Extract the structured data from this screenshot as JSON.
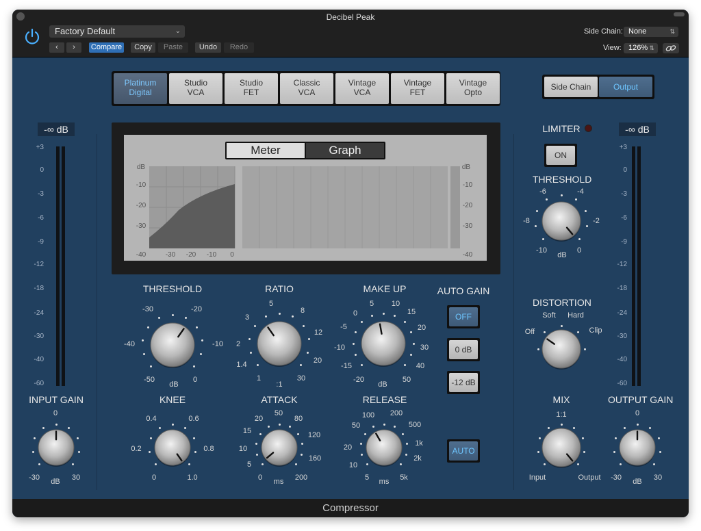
{
  "window": {
    "title": "Decibel Peak",
    "footer": "Compressor"
  },
  "toolbar": {
    "preset": "Factory Default",
    "compare": "Compare",
    "copy": "Copy",
    "paste": "Paste",
    "undo": "Undo",
    "redo": "Redo",
    "side_chain_label": "Side Chain:",
    "side_chain_value": "None",
    "view_label": "View:",
    "view_value": "126%"
  },
  "models": [
    "Platinum\nDigital",
    "Studio\nVCA",
    "Studio\nFET",
    "Classic\nVCA",
    "Vintage\nVCA",
    "Vintage\nFET",
    "Vintage\nOpto"
  ],
  "selected_model": 0,
  "detector": {
    "side_chain": "Side Chain",
    "output": "Output",
    "selected": "Output"
  },
  "display": {
    "meter": "Meter",
    "graph": "Graph",
    "db": "dB",
    "y_ticks": [
      "-10",
      "-20",
      "-30",
      "-40"
    ],
    "x_ticks": [
      "-30",
      "-20",
      "-10",
      "0"
    ]
  },
  "meters": {
    "input_value": "-∞ dB",
    "output_value": "-∞ dB",
    "scale": [
      "+3",
      "0",
      "-3",
      "-6",
      "-9",
      "-12",
      "-18",
      "-24",
      "-30",
      "-40",
      "-60"
    ]
  },
  "knobs": {
    "threshold": {
      "label": "THRESHOLD",
      "ticks": [
        "-30",
        "-20",
        "-40",
        "-10",
        "-50",
        "dB",
        "0"
      ]
    },
    "ratio": {
      "label": "RATIO",
      "ticks": [
        "5",
        "3",
        "8",
        "2",
        "12",
        "1.4",
        "20",
        "1",
        ":1",
        "30"
      ]
    },
    "makeup": {
      "label": "MAKE UP",
      "ticks": [
        "5",
        "10",
        "0",
        "15",
        "-5",
        "20",
        "-10",
        "30",
        "-15",
        "40",
        "-20",
        "dB",
        "50"
      ]
    },
    "knee": {
      "label": "KNEE",
      "ticks": [
        "0.4",
        "0.6",
        "0.2",
        "0.8",
        "0",
        "1.0"
      ]
    },
    "attack": {
      "label": "ATTACK",
      "ticks": [
        "50",
        "20",
        "80",
        "15",
        "120",
        "10",
        "160",
        "5",
        "0",
        "ms",
        "200"
      ]
    },
    "release": {
      "label": "RELEASE",
      "ticks": [
        "100",
        "200",
        "50",
        "500",
        "20",
        "1k",
        "10",
        "2k",
        "5",
        "ms",
        "5k"
      ]
    },
    "input_gain": {
      "label": "INPUT GAIN",
      "ticks": [
        "0",
        "-30",
        "dB",
        "30"
      ]
    },
    "output_gain": {
      "label": "OUTPUT GAIN",
      "ticks": [
        "0",
        "-30",
        "dB",
        "30"
      ]
    },
    "limiter_threshold": {
      "label": "THRESHOLD",
      "ticks": [
        "-6",
        "-4",
        "-8",
        "-2",
        "-10",
        "dB",
        "0"
      ]
    },
    "distortion": {
      "label": "DISTORTION",
      "ticks": [
        "Soft",
        "Hard",
        "Off",
        "Clip"
      ]
    },
    "mix": {
      "label": "MIX",
      "ticks": [
        "1:1",
        "Input",
        "Output"
      ]
    }
  },
  "auto_gain": {
    "label": "AUTO GAIN",
    "off": "OFF",
    "zero": "0 dB",
    "minus12": "-12 dB"
  },
  "auto_release": "AUTO",
  "limiter": {
    "label": "LIMITER",
    "on": "ON"
  }
}
